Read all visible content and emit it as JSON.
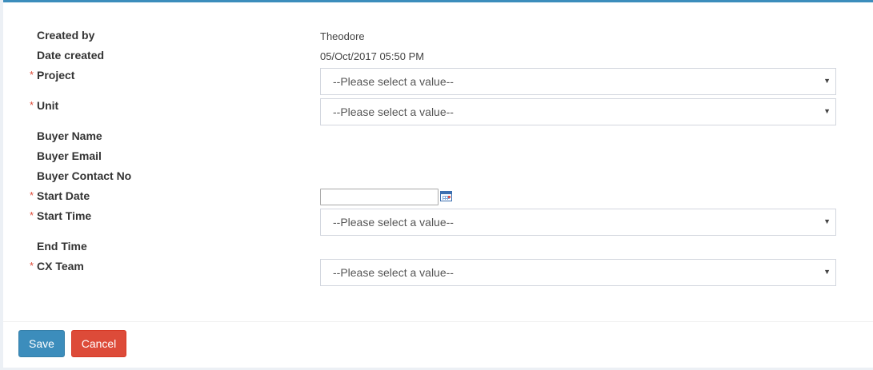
{
  "form": {
    "created_by": {
      "label": "Created by",
      "value": "Theodore"
    },
    "date_created": {
      "label": "Date created",
      "value": "05/Oct/2017 05:50 PM"
    },
    "project": {
      "label": "Project",
      "required_mark": "*",
      "placeholder": "--Please select a value--"
    },
    "unit": {
      "label": "Unit",
      "required_mark": "*",
      "placeholder": "--Please select a value--"
    },
    "buyer_name": {
      "label": "Buyer Name"
    },
    "buyer_email": {
      "label": "Buyer Email"
    },
    "buyer_contact": {
      "label": "Buyer Contact No"
    },
    "start_date": {
      "label": "Start Date",
      "required_mark": "*",
      "value": ""
    },
    "start_time": {
      "label": "Start Time",
      "required_mark": "*",
      "placeholder": "--Please select a value--"
    },
    "end_time": {
      "label": "End Time"
    },
    "cx_team": {
      "label": "CX Team",
      "required_mark": "*",
      "placeholder": "--Please select a value--"
    }
  },
  "footer": {
    "save_label": "Save",
    "cancel_label": "Cancel"
  },
  "icons": {
    "select_caret": "▼",
    "calendar": "calendar-icon"
  },
  "colors": {
    "accent": "#3c8dbc",
    "danger": "#dd4b39",
    "required": "#dd4b39"
  }
}
